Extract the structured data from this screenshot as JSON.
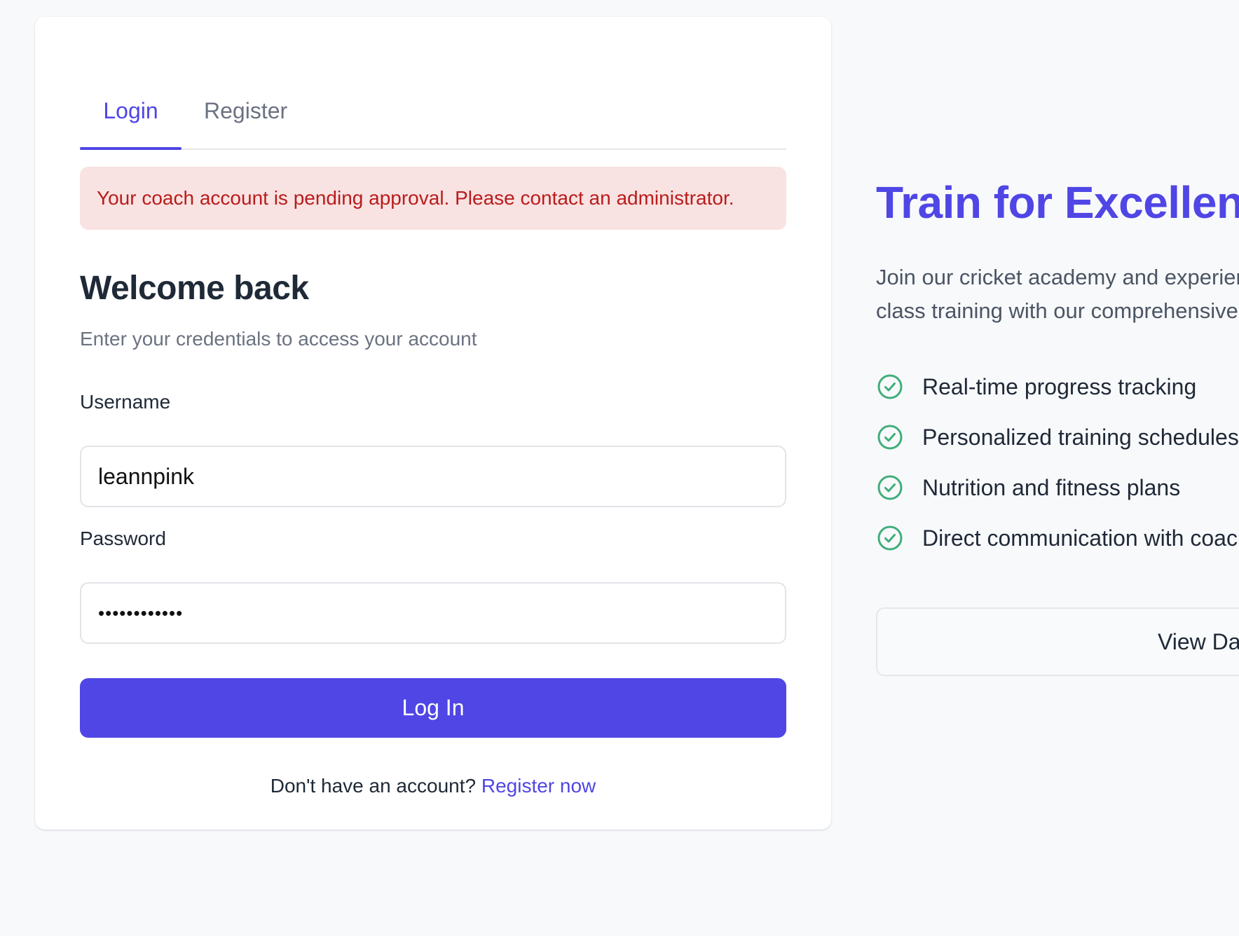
{
  "tabs": [
    {
      "label": "Login",
      "active": true
    },
    {
      "label": "Register",
      "active": false
    }
  ],
  "alert": {
    "message": "Your coach account is pending approval. Please contact an administrator."
  },
  "form": {
    "title": "Welcome back",
    "subtitle": "Enter your credentials to access your account",
    "username_label": "Username",
    "username_value": "leannpink",
    "password_label": "Password",
    "password_value": "••••••••••••",
    "submit_label": "Log In",
    "footer_text": "Don't have an account?",
    "footer_link": "Register now"
  },
  "hero": {
    "title": "Train for Excellence",
    "description": "Join our cricket academy and experience world-class training with our comprehensive platform.",
    "features": [
      {
        "text": "Real-time progress tracking",
        "icon": "check-circle-icon"
      },
      {
        "text": "Personalized training schedules",
        "icon": "check-circle-icon"
      },
      {
        "text": "Nutrition and fitness plans",
        "icon": "check-circle-icon"
      },
      {
        "text": "Direct communication with coaches",
        "icon": "check-circle-icon"
      }
    ],
    "cta_label": "View Dashboard"
  },
  "colors": {
    "accent": "#4f46e5",
    "alert_bg": "#f9e2e2",
    "alert_text": "#b91c1c",
    "check": "#3fae7a"
  }
}
